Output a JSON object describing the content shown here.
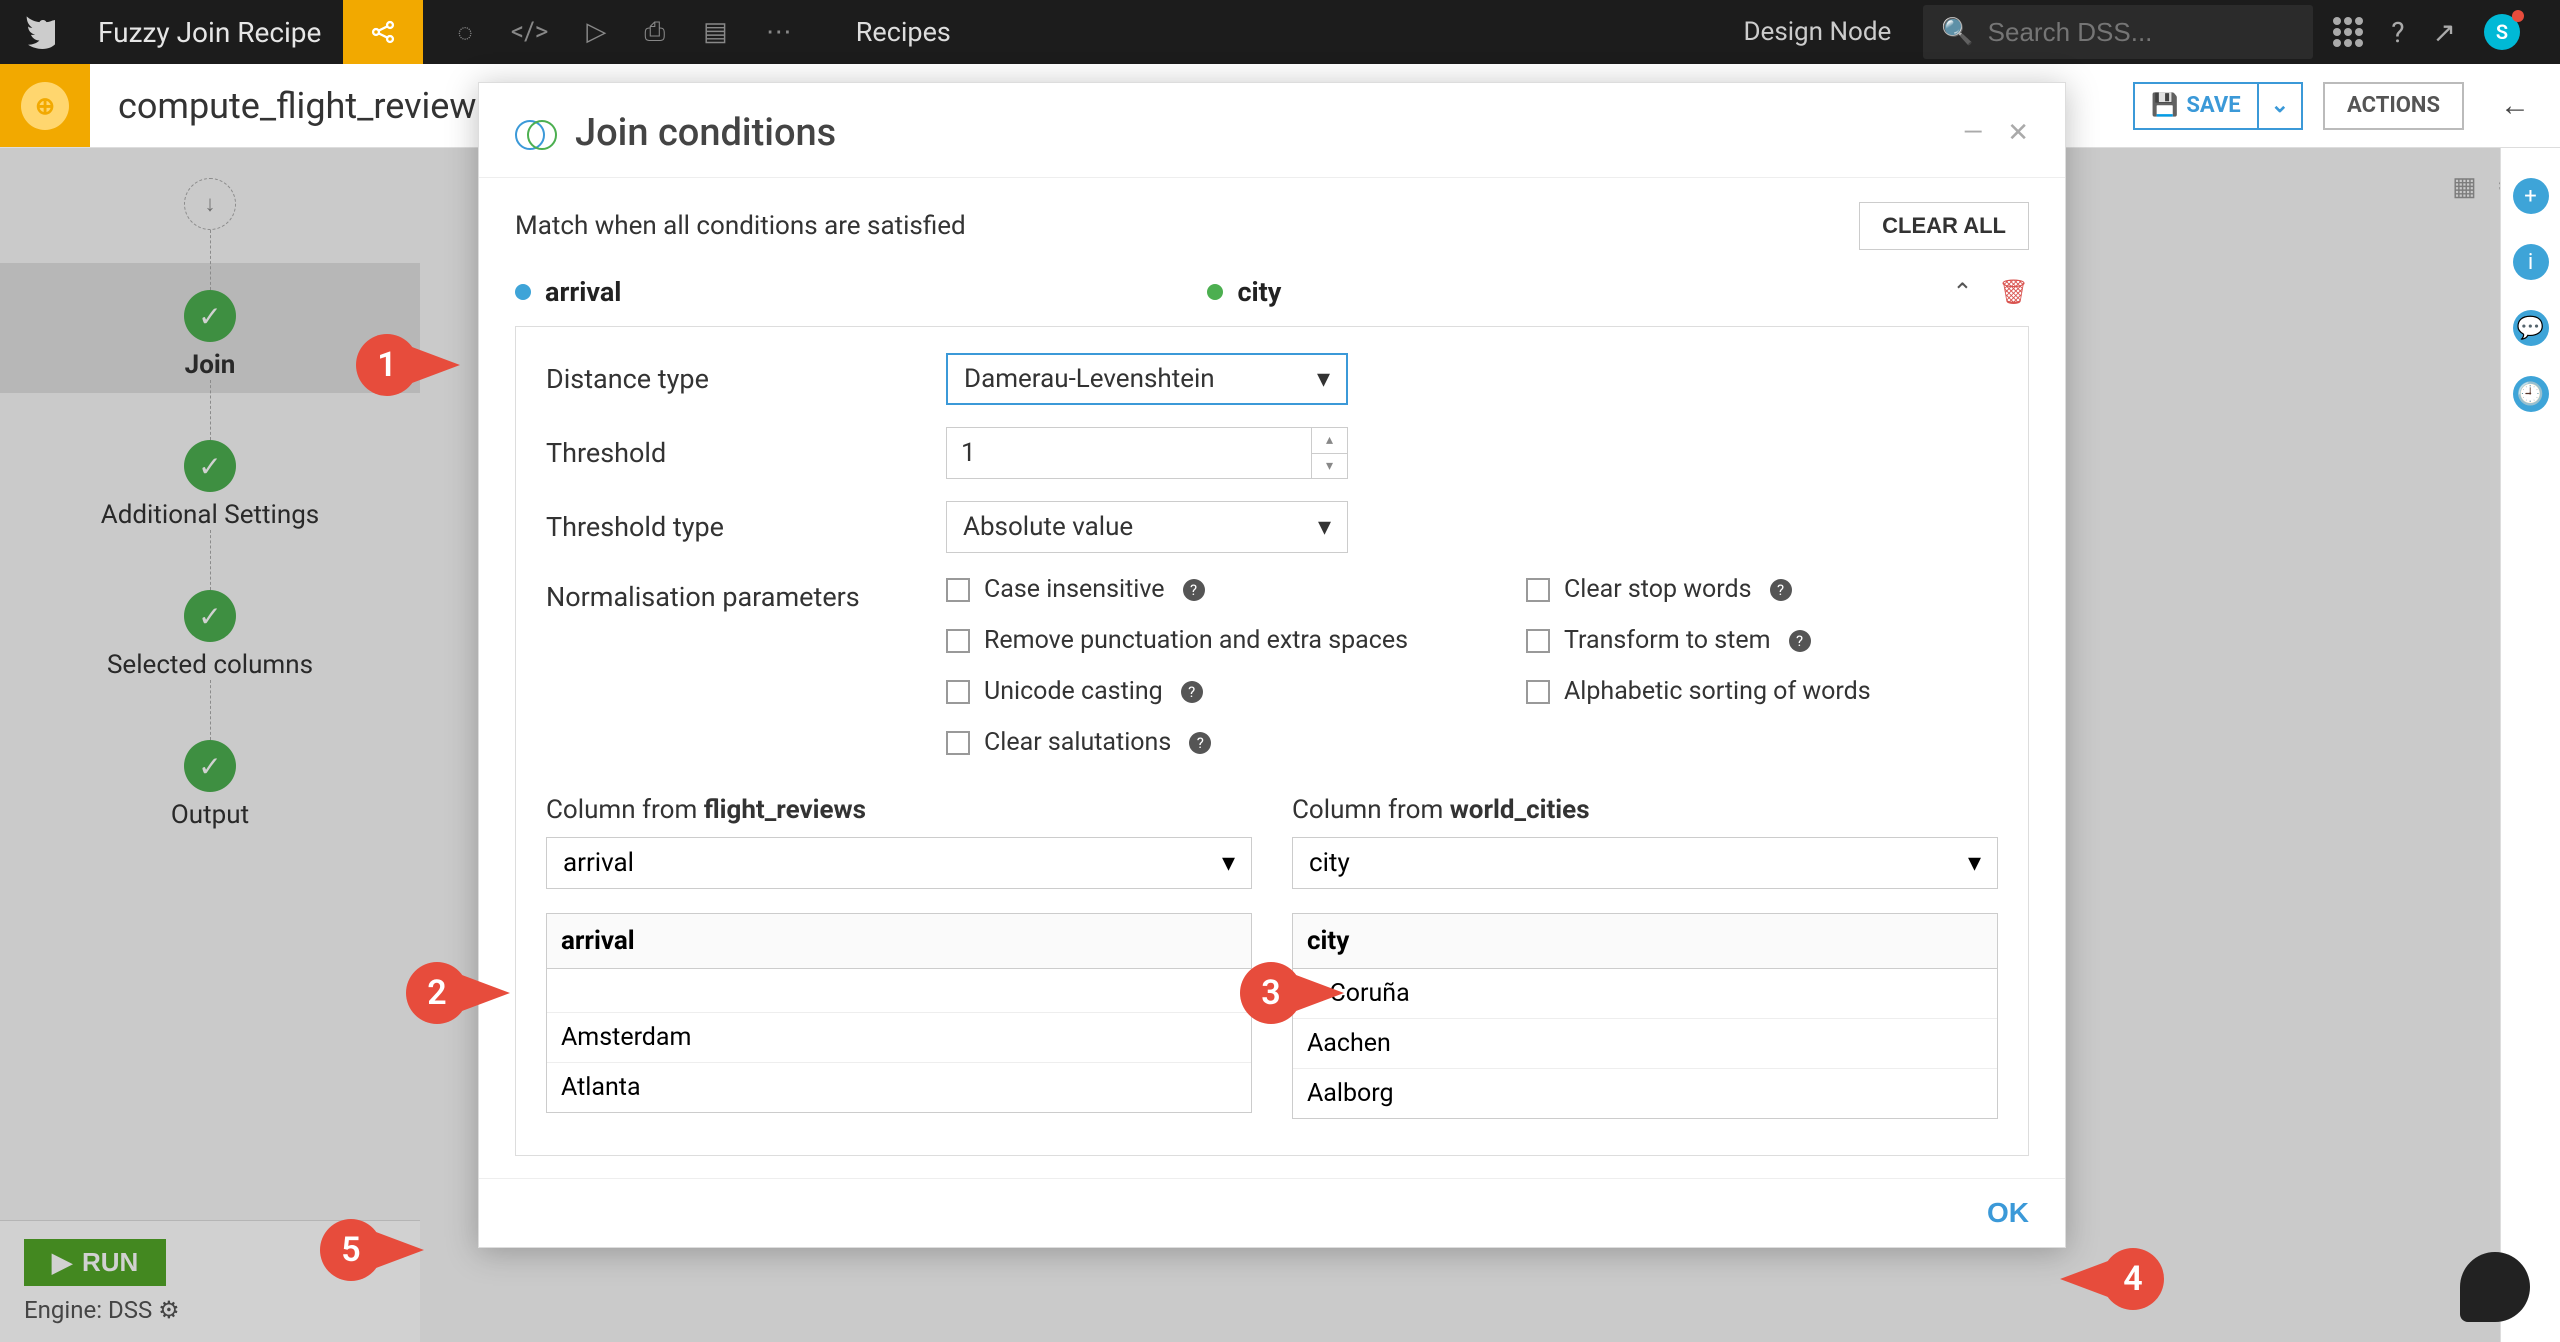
{
  "topbar": {
    "recipe_name": "Fuzzy Join Recipe",
    "recipes_label": "Recipes",
    "design_node": "Design Node",
    "search_placeholder": "Search DSS...",
    "avatar_initial": "S"
  },
  "header": {
    "compute_name": "compute_flight_review",
    "save_label": "SAVE",
    "actions_label": "ACTIONS"
  },
  "steps": {
    "join": "Join",
    "additional": "Additional Settings",
    "selected": "Selected columns",
    "output": "Output"
  },
  "runbar": {
    "run_label": "RUN",
    "engine_label": "Engine: DSS"
  },
  "modal": {
    "title": "Join conditions",
    "match_text": "Match when all conditions are satisfied",
    "clear_all": "CLEAR ALL",
    "left_col": "arrival",
    "right_col": "city",
    "fields": {
      "distance_type_label": "Distance type",
      "distance_type_value": "Damerau-Levenshtein",
      "threshold_label": "Threshold",
      "threshold_value": "1",
      "threshold_type_label": "Threshold type",
      "threshold_type_value": "Absolute value",
      "norm_label": "Normalisation parameters"
    },
    "checks_left": [
      "Case insensitive",
      "Remove punctuation and extra spaces",
      "Unicode casting",
      "Clear salutations"
    ],
    "checks_right": [
      "Clear stop words",
      "Transform to stem",
      "Alphabetic sorting of words"
    ],
    "column_from": {
      "left_label_prefix": "Column from ",
      "left_label_bold": "flight_reviews",
      "left_value": "arrival",
      "left_header": "arrival",
      "left_rows": [
        "Amsterdam",
        "Atlanta"
      ],
      "right_label_prefix": "Column from ",
      "right_label_bold": "world_cities",
      "right_value": "city",
      "right_header": "city",
      "right_rows": [
        "A Coruña",
        "Aachen",
        "Aalborg"
      ]
    },
    "ok_label": "OK"
  },
  "callouts": {
    "c1": "1",
    "c2": "2",
    "c3": "3",
    "c4": "4",
    "c5": "5"
  }
}
